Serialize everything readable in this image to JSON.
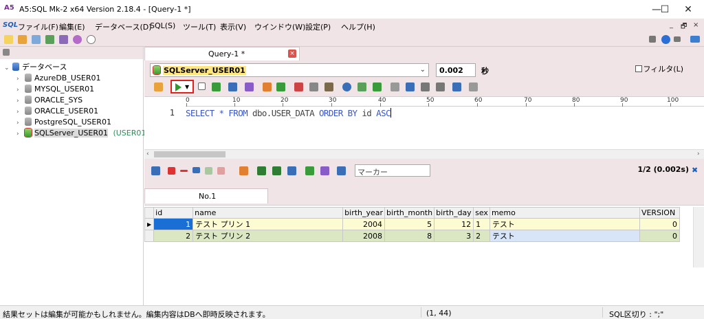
{
  "window": {
    "title": "A5:SQL Mk-2 x64 Version 2.18.4 - [Query-1 *]",
    "minimize": "—",
    "maximize": "☐",
    "close": "✕"
  },
  "menu": {
    "logo": "SQL",
    "items": [
      "ファイル(F)",
      "編集(E)",
      "データベース(D)",
      "SQL(S)",
      "ツール(T)",
      "表示(V)",
      "ウインドウ(W)",
      "設定(P)",
      "ヘルプ(H)"
    ],
    "mdi": [
      "_",
      "🗗",
      "×"
    ]
  },
  "tree": {
    "root": "データベース",
    "items": [
      "AzureDB_USER01",
      "MYSQL_USER01",
      "ORACLE_SYS",
      "ORACLE_USER01",
      "PostgreSQL_USER01",
      "SQLServer_USER01"
    ],
    "active_suffix": "(USER01)"
  },
  "query_tab": {
    "label": "Query-1 *",
    "close": "×"
  },
  "connection": {
    "name": "SQLServer_USER01",
    "elapsed": "0.002",
    "unit": "秒"
  },
  "editor": {
    "ruler": [
      "0",
      "10",
      "20",
      "30",
      "40",
      "50",
      "60",
      "70",
      "80",
      "90",
      "100"
    ],
    "line_number": "1",
    "code": {
      "select": "SELECT",
      "star": "*",
      "from": "FROM",
      "table": "dbo.USER_DATA",
      "order": "ORDER",
      "by": "BY",
      "col": "id",
      "asc": "ASC"
    }
  },
  "result": {
    "marker_placeholder": "マーカー",
    "page_info": "1/2 (0.002s)",
    "filter_label": "フィルタ(L)",
    "tab_label": "No.1",
    "columns": [
      "id",
      "name",
      "birth_year",
      "birth_month",
      "birth_day",
      "sex",
      "memo",
      "VERSION"
    ],
    "rows": [
      [
        "1",
        "テスト プリン 1",
        "2004",
        "5",
        "12",
        "1",
        "テスト",
        "0"
      ],
      [
        "2",
        "テスト プリン 2",
        "2008",
        "8",
        "3",
        "2",
        "テスト",
        "0"
      ]
    ]
  },
  "status": {
    "message": "結果セットは編集が可能かもしれません。編集内容はDBへ即時反映されます。",
    "position": "(1, 44)",
    "separator": "SQL区切り : \";\""
  },
  "colors": {
    "pane_bg": "#f0e4e6",
    "keyword": "#3a55c9",
    "run_highlight": "#e0201b",
    "row_odd": "#fdfbd2",
    "row_even": "#dbe6c3",
    "active_cell": "#1a6fd6"
  }
}
